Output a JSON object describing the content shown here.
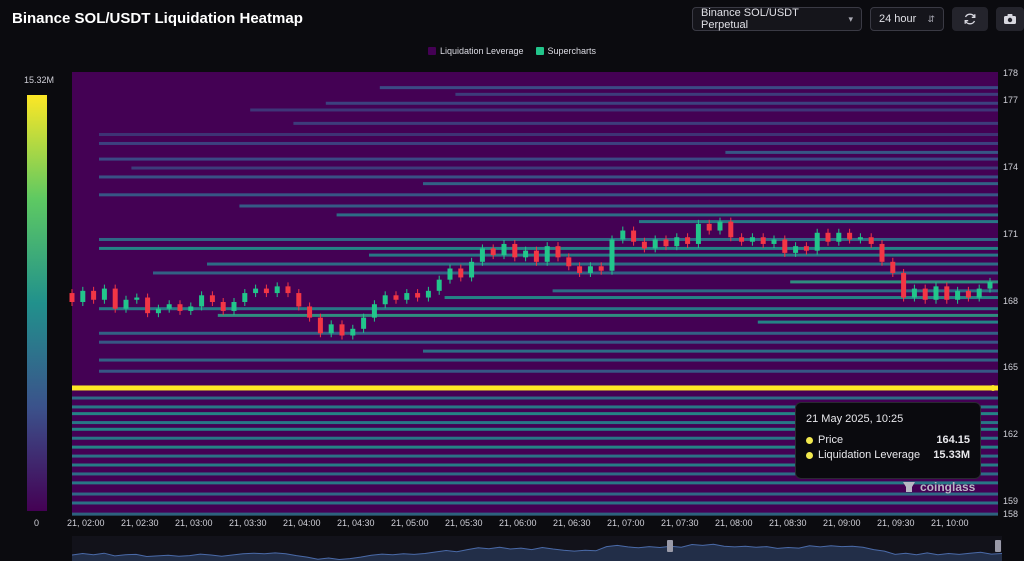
{
  "header": {
    "title": "Binance SOL/USDT Liquidation Heatmap",
    "exchange_select": "Binance SOL/USDT Perpetual",
    "range_select": "24 hour",
    "refresh_icon": "refresh-icon",
    "camera_icon": "camera-icon"
  },
  "legend": {
    "items": [
      {
        "label": "Liquidation Leverage",
        "color": "#440154"
      },
      {
        "label": "Supercharts",
        "color": "#22c58b"
      }
    ]
  },
  "color_scale": {
    "max_label": "15.32M",
    "min_label": "0"
  },
  "tooltip": {
    "title": "21 May 2025, 10:25",
    "rows": [
      {
        "label": "Price",
        "value": "164.15"
      },
      {
        "label": "Liquidation Leverage",
        "value": "15.33M"
      }
    ]
  },
  "watermark": "coinglass",
  "colors": {
    "up": "#22c58b",
    "down": "#f23645",
    "background": "#440154",
    "hot": "#fde725"
  },
  "chart_data": {
    "type": "heatmap",
    "title": "Binance SOL/USDT Liquidation Heatmap",
    "x_tick_labels": [
      "21, 02:00",
      "21, 02:30",
      "21, 03:00",
      "21, 03:30",
      "21, 04:00",
      "21, 04:30",
      "21, 05:00",
      "21, 05:30",
      "21, 06:00",
      "21, 06:30",
      "21, 07:00",
      "21, 07:30",
      "21, 08:00",
      "21, 08:30",
      "21, 09:00",
      "21, 09:30",
      "21, 10:00"
    ],
    "y_tick_labels": [
      "178",
      "177",
      "174",
      "171",
      "168",
      "165",
      "162",
      "159",
      "158"
    ],
    "ylim": [
      158,
      178
    ],
    "xlim": [
      1.75,
      10.4
    ],
    "colorbar_range": [
      0,
      15.32
    ],
    "colorbar_label_max": "15.32M",
    "hot_level": {
      "price": 164.15,
      "value_m": 15.33
    },
    "liquidation_bands": [
      {
        "price": 177.6,
        "start": 4.6,
        "value": 0.25
      },
      {
        "price": 177.3,
        "start": 5.3,
        "value": 0.2
      },
      {
        "price": 176.9,
        "start": 4.1,
        "value": 0.22
      },
      {
        "price": 176.6,
        "start": 3.4,
        "value": 0.18
      },
      {
        "price": 176.0,
        "start": 3.8,
        "value": 0.2
      },
      {
        "price": 175.5,
        "start": 2.0,
        "value": 0.17
      },
      {
        "price": 175.1,
        "start": 2.0,
        "value": 0.22
      },
      {
        "price": 174.7,
        "start": 7.8,
        "value": 0.3
      },
      {
        "price": 174.4,
        "start": 2.0,
        "value": 0.25
      },
      {
        "price": 174.0,
        "start": 2.3,
        "value": 0.2
      },
      {
        "price": 173.6,
        "start": 2.0,
        "value": 0.28
      },
      {
        "price": 173.3,
        "start": 5.0,
        "value": 0.35
      },
      {
        "price": 172.8,
        "start": 2.0,
        "value": 0.3
      },
      {
        "price": 172.3,
        "start": 3.3,
        "value": 0.32
      },
      {
        "price": 171.9,
        "start": 4.2,
        "value": 0.4
      },
      {
        "price": 171.6,
        "start": 7.0,
        "value": 0.45
      },
      {
        "price": 170.8,
        "start": 2.0,
        "value": 0.38
      },
      {
        "price": 170.4,
        "start": 2.0,
        "value": 0.5
      },
      {
        "price": 170.1,
        "start": 4.5,
        "value": 0.45
      },
      {
        "price": 169.7,
        "start": 3.0,
        "value": 0.4
      },
      {
        "price": 169.3,
        "start": 2.5,
        "value": 0.35
      },
      {
        "price": 168.9,
        "start": 8.4,
        "value": 0.55
      },
      {
        "price": 168.5,
        "start": 6.2,
        "value": 0.4
      },
      {
        "price": 168.2,
        "start": 5.2,
        "value": 0.5
      },
      {
        "price": 167.7,
        "start": 2.0,
        "value": 0.45
      },
      {
        "price": 167.4,
        "start": 3.1,
        "value": 0.55
      },
      {
        "price": 167.1,
        "start": 8.1,
        "value": 0.5
      },
      {
        "price": 166.6,
        "start": 2.0,
        "value": 0.35
      },
      {
        "price": 166.2,
        "start": 2.0,
        "value": 0.3
      },
      {
        "price": 165.8,
        "start": 5.0,
        "value": 0.4
      },
      {
        "price": 165.4,
        "start": 2.0,
        "value": 0.35
      },
      {
        "price": 164.9,
        "start": 2.0,
        "value": 0.3
      },
      {
        "price": 164.15,
        "start": 1.75,
        "value": 1.0
      },
      {
        "price": 163.7,
        "start": 1.75,
        "value": 0.4
      },
      {
        "price": 163.3,
        "start": 1.75,
        "value": 0.45
      },
      {
        "price": 163.0,
        "start": 1.75,
        "value": 0.5
      },
      {
        "price": 162.6,
        "start": 1.75,
        "value": 0.45
      },
      {
        "price": 162.3,
        "start": 1.75,
        "value": 0.5
      },
      {
        "price": 161.9,
        "start": 1.75,
        "value": 0.45
      },
      {
        "price": 161.5,
        "start": 1.75,
        "value": 0.5
      },
      {
        "price": 161.1,
        "start": 1.75,
        "value": 0.42
      },
      {
        "price": 160.7,
        "start": 1.75,
        "value": 0.47
      },
      {
        "price": 160.3,
        "start": 1.75,
        "value": 0.4
      },
      {
        "price": 159.9,
        "start": 1.75,
        "value": 0.45
      },
      {
        "price": 159.4,
        "start": 1.75,
        "value": 0.38
      },
      {
        "price": 159.0,
        "start": 1.75,
        "value": 0.42
      },
      {
        "price": 158.5,
        "start": 1.75,
        "value": 0.35
      }
    ],
    "candles": [
      {
        "t": 1.75,
        "o": 168.4,
        "c": 168.0
      },
      {
        "t": 1.85,
        "o": 168.0,
        "c": 168.5
      },
      {
        "t": 1.95,
        "o": 168.5,
        "c": 168.1
      },
      {
        "t": 2.05,
        "o": 168.1,
        "c": 168.6
      },
      {
        "t": 2.15,
        "o": 168.6,
        "c": 167.7
      },
      {
        "t": 2.25,
        "o": 167.7,
        "c": 168.1
      },
      {
        "t": 2.35,
        "o": 168.1,
        "c": 168.2
      },
      {
        "t": 2.45,
        "o": 168.2,
        "c": 167.5
      },
      {
        "t": 2.55,
        "o": 167.5,
        "c": 167.7
      },
      {
        "t": 2.65,
        "o": 167.7,
        "c": 167.9
      },
      {
        "t": 2.75,
        "o": 167.9,
        "c": 167.6
      },
      {
        "t": 2.85,
        "o": 167.6,
        "c": 167.8
      },
      {
        "t": 2.95,
        "o": 167.8,
        "c": 168.3
      },
      {
        "t": 3.05,
        "o": 168.3,
        "c": 168.0
      },
      {
        "t": 3.15,
        "o": 168.0,
        "c": 167.6
      },
      {
        "t": 3.25,
        "o": 167.6,
        "c": 168.0
      },
      {
        "t": 3.35,
        "o": 168.0,
        "c": 168.4
      },
      {
        "t": 3.45,
        "o": 168.4,
        "c": 168.6
      },
      {
        "t": 3.55,
        "o": 168.6,
        "c": 168.4
      },
      {
        "t": 3.65,
        "o": 168.4,
        "c": 168.7
      },
      {
        "t": 3.75,
        "o": 168.7,
        "c": 168.4
      },
      {
        "t": 3.85,
        "o": 168.4,
        "c": 167.8
      },
      {
        "t": 3.95,
        "o": 167.8,
        "c": 167.3
      },
      {
        "t": 4.05,
        "o": 167.3,
        "c": 166.6
      },
      {
        "t": 4.15,
        "o": 166.6,
        "c": 167.0
      },
      {
        "t": 4.25,
        "o": 167.0,
        "c": 166.5
      },
      {
        "t": 4.35,
        "o": 166.5,
        "c": 166.8
      },
      {
        "t": 4.45,
        "o": 166.8,
        "c": 167.3
      },
      {
        "t": 4.55,
        "o": 167.3,
        "c": 167.9
      },
      {
        "t": 4.65,
        "o": 167.9,
        "c": 168.3
      },
      {
        "t": 4.75,
        "o": 168.3,
        "c": 168.1
      },
      {
        "t": 4.85,
        "o": 168.1,
        "c": 168.4
      },
      {
        "t": 4.95,
        "o": 168.4,
        "c": 168.2
      },
      {
        "t": 5.05,
        "o": 168.2,
        "c": 168.5
      },
      {
        "t": 5.15,
        "o": 168.5,
        "c": 169.0
      },
      {
        "t": 5.25,
        "o": 169.0,
        "c": 169.5
      },
      {
        "t": 5.35,
        "o": 169.5,
        "c": 169.1
      },
      {
        "t": 5.45,
        "o": 169.1,
        "c": 169.8
      },
      {
        "t": 5.55,
        "o": 169.8,
        "c": 170.4
      },
      {
        "t": 5.65,
        "o": 170.4,
        "c": 170.1
      },
      {
        "t": 5.75,
        "o": 170.1,
        "c": 170.6
      },
      {
        "t": 5.85,
        "o": 170.6,
        "c": 170.0
      },
      {
        "t": 5.95,
        "o": 170.0,
        "c": 170.3
      },
      {
        "t": 6.05,
        "o": 170.3,
        "c": 169.8
      },
      {
        "t": 6.15,
        "o": 169.8,
        "c": 170.5
      },
      {
        "t": 6.25,
        "o": 170.5,
        "c": 170.0
      },
      {
        "t": 6.35,
        "o": 170.0,
        "c": 169.6
      },
      {
        "t": 6.45,
        "o": 169.6,
        "c": 169.3
      },
      {
        "t": 6.55,
        "o": 169.3,
        "c": 169.6
      },
      {
        "t": 6.65,
        "o": 169.6,
        "c": 169.4
      },
      {
        "t": 6.75,
        "o": 169.4,
        "c": 170.8
      },
      {
        "t": 6.85,
        "o": 170.8,
        "c": 171.2
      },
      {
        "t": 6.95,
        "o": 171.2,
        "c": 170.7
      },
      {
        "t": 7.05,
        "o": 170.7,
        "c": 170.4
      },
      {
        "t": 7.15,
        "o": 170.4,
        "c": 170.8
      },
      {
        "t": 7.25,
        "o": 170.8,
        "c": 170.5
      },
      {
        "t": 7.35,
        "o": 170.5,
        "c": 170.9
      },
      {
        "t": 7.45,
        "o": 170.9,
        "c": 170.6
      },
      {
        "t": 7.55,
        "o": 170.6,
        "c": 171.5
      },
      {
        "t": 7.65,
        "o": 171.5,
        "c": 171.2
      },
      {
        "t": 7.75,
        "o": 171.2,
        "c": 171.6
      },
      {
        "t": 7.85,
        "o": 171.6,
        "c": 170.9
      },
      {
        "t": 7.95,
        "o": 170.9,
        "c": 170.7
      },
      {
        "t": 8.05,
        "o": 170.7,
        "c": 170.9
      },
      {
        "t": 8.15,
        "o": 170.9,
        "c": 170.6
      },
      {
        "t": 8.25,
        "o": 170.6,
        "c": 170.8
      },
      {
        "t": 8.35,
        "o": 170.8,
        "c": 170.2
      },
      {
        "t": 8.45,
        "o": 170.2,
        "c": 170.5
      },
      {
        "t": 8.55,
        "o": 170.5,
        "c": 170.3
      },
      {
        "t": 8.65,
        "o": 170.3,
        "c": 171.1
      },
      {
        "t": 8.75,
        "o": 171.1,
        "c": 170.7
      },
      {
        "t": 8.85,
        "o": 170.7,
        "c": 171.1
      },
      {
        "t": 8.95,
        "o": 171.1,
        "c": 170.8
      },
      {
        "t": 9.05,
        "o": 170.8,
        "c": 170.9
      },
      {
        "t": 9.15,
        "o": 170.9,
        "c": 170.6
      },
      {
        "t": 9.25,
        "o": 170.6,
        "c": 169.8
      },
      {
        "t": 9.35,
        "o": 169.8,
        "c": 169.3
      },
      {
        "t": 9.45,
        "o": 169.3,
        "c": 168.2
      },
      {
        "t": 9.55,
        "o": 168.2,
        "c": 168.6
      },
      {
        "t": 9.65,
        "o": 168.6,
        "c": 168.1
      },
      {
        "t": 9.75,
        "o": 168.1,
        "c": 168.7
      },
      {
        "t": 9.85,
        "o": 168.7,
        "c": 168.1
      },
      {
        "t": 9.95,
        "o": 168.1,
        "c": 168.5
      },
      {
        "t": 10.05,
        "o": 168.5,
        "c": 168.2
      },
      {
        "t": 10.15,
        "o": 168.2,
        "c": 168.6
      },
      {
        "t": 10.25,
        "o": 168.6,
        "c": 168.9
      },
      {
        "t": 10.35,
        "o": 168.9,
        "c": 168.3
      },
      {
        "t": 10.45,
        "o": 168.3,
        "c": 168.5
      }
    ]
  }
}
